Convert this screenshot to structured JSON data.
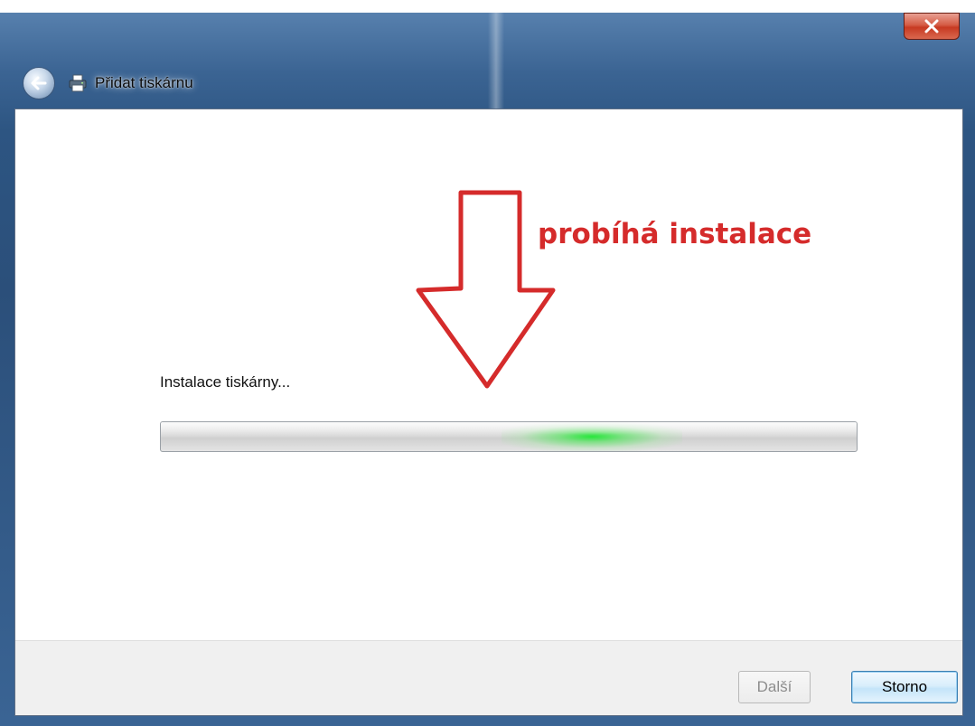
{
  "window": {
    "title": "Přidat tiskárnu",
    "close_icon": "close-icon",
    "back_icon": "back-arrow-icon",
    "printer_icon": "printer-icon"
  },
  "annotation": {
    "text": "probíhá instalace",
    "color": "#d52b2b",
    "arrow_icon": "down-arrow-icon"
  },
  "status": {
    "label": "Instalace tiskárny...",
    "progress_style": "marquee",
    "glow_position": 0.62,
    "glow_color": "#28e63c"
  },
  "buttons": {
    "next_label": "Další",
    "next_enabled": false,
    "cancel_label": "Storno"
  }
}
